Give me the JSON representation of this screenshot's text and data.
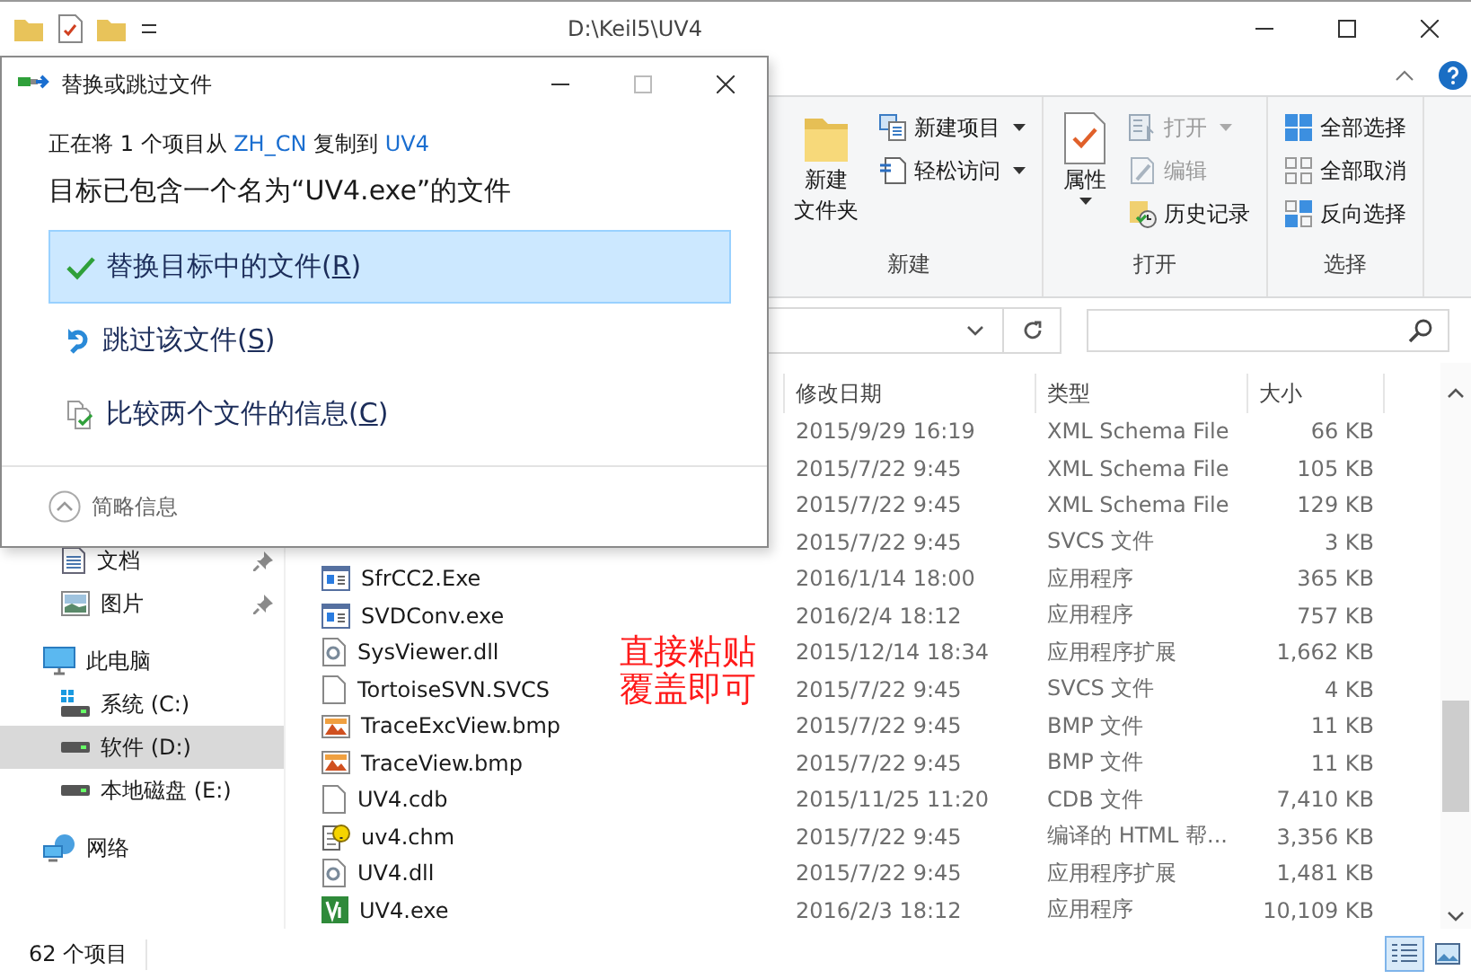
{
  "explorer": {
    "title": "D:\\Keil5\\UV4"
  },
  "ribbon": {
    "groups": [
      {
        "label": "新建",
        "items": [
          {
            "kind": "new-folder",
            "label_lines": [
              "新建",
              "文件夹"
            ],
            "menu": false,
            "disabled": false
          },
          {
            "kind": "new-item",
            "label_lines": [
              "新建项目"
            ],
            "menu": true,
            "disabled": false
          },
          {
            "kind": "easy-access",
            "label_lines": [
              "轻松访问"
            ],
            "menu": true,
            "disabled": false
          }
        ]
      },
      {
        "label": "打开",
        "items": [
          {
            "kind": "properties",
            "label_lines": [
              "属性"
            ],
            "menu": true,
            "disabled": false
          },
          {
            "kind": "open",
            "label_lines": [
              "打开"
            ],
            "menu": true,
            "disabled": true
          },
          {
            "kind": "edit",
            "label_lines": [
              "编辑"
            ],
            "menu": false,
            "disabled": true
          },
          {
            "kind": "history",
            "label_lines": [
              "历史记录"
            ],
            "menu": false,
            "disabled": false
          }
        ]
      },
      {
        "label": "选择",
        "items": [
          {
            "kind": "select-all",
            "label_lines": [
              "全部选择"
            ],
            "menu": false,
            "disabled": false
          },
          {
            "kind": "select-none",
            "label_lines": [
              "全部取消"
            ],
            "menu": false,
            "disabled": false
          },
          {
            "kind": "invert",
            "label_lines": [
              "反向选择"
            ],
            "menu": false,
            "disabled": false
          }
        ]
      }
    ]
  },
  "navigation": {
    "items": [
      {
        "kind": "documents",
        "label": "文档",
        "pinned": true,
        "selected": false
      },
      {
        "kind": "pictures",
        "label": "图片",
        "pinned": true,
        "selected": false
      },
      {
        "kind": "computer",
        "label": "此电脑",
        "pinned": false,
        "selected": false,
        "children": [
          {
            "kind": "system-drive",
            "label": "系统 (C:)",
            "pinned": false,
            "selected": false
          },
          {
            "kind": "drive",
            "label": "软件 (D:)",
            "pinned": false,
            "selected": true
          },
          {
            "kind": "drive",
            "label": "本地磁盘 (E:)",
            "pinned": false,
            "selected": false
          }
        ]
      },
      {
        "kind": "network",
        "label": "网络",
        "pinned": false,
        "selected": false
      }
    ]
  },
  "files": {
    "columns": [
      "修改日期",
      "类型",
      "大小"
    ],
    "rows": [
      {
        "date": "2015/9/29 16:19",
        "type": "XML Schema File",
        "size": "66 KB"
      },
      {
        "date": "2015/7/22 9:45",
        "type": "XML Schema File",
        "size": "105 KB"
      },
      {
        "date": "2015/7/22 9:45",
        "type": "XML Schema File",
        "size": "129 KB"
      },
      {
        "date": "2015/7/22 9:45",
        "type": "SVCS 文件",
        "size": "3 KB"
      },
      {
        "kind": "app",
        "name": "SfrCC2.Exe",
        "date": "2016/1/14 18:00",
        "type": "应用程序",
        "size": "365 KB"
      },
      {
        "kind": "app",
        "name": "SVDConv.exe",
        "date": "2016/2/4 18:12",
        "type": "应用程序",
        "size": "757 KB"
      },
      {
        "kind": "dll",
        "name": "SysViewer.dll",
        "date": "2015/12/14 18:34",
        "type": "应用程序扩展",
        "size": "1,662 KB"
      },
      {
        "kind": "file",
        "name": "TortoiseSVN.SVCS",
        "date": "2015/7/22 9:45",
        "type": "SVCS 文件",
        "size": "4 KB"
      },
      {
        "kind": "bmp",
        "name": "TraceExcView.bmp",
        "date": "2015/7/22 9:45",
        "type": "BMP 文件",
        "size": "11 KB"
      },
      {
        "kind": "bmp",
        "name": "TraceView.bmp",
        "date": "2015/7/22 9:45",
        "type": "BMP 文件",
        "size": "11 KB"
      },
      {
        "kind": "file",
        "name": "UV4.cdb",
        "date": "2015/11/25 11:20",
        "type": "CDB 文件",
        "size": "7,410 KB"
      },
      {
        "kind": "help",
        "name": "uv4.chm",
        "date": "2015/7/22 9:45",
        "type": "编译的 HTML 帮...",
        "size": "3,356 KB"
      },
      {
        "kind": "dll",
        "name": "UV4.dll",
        "date": "2015/7/22 9:45",
        "type": "应用程序扩展",
        "size": "1,481 KB"
      },
      {
        "kind": "uv",
        "name": "UV4.exe",
        "date": "2016/2/3 18:12",
        "type": "应用程序",
        "size": "10,109 KB"
      }
    ]
  },
  "status_bar": {
    "count": "62 个项目",
    "views": [
      {
        "kind": "details",
        "selected": true
      },
      {
        "kind": "large-icons",
        "selected": false
      }
    ]
  },
  "annotation_lines": [
    "直接粘贴",
    "覆盖即可"
  ],
  "dialog": {
    "title": "替换或跳过文件",
    "source_line": [
      {
        "text": "正在将 1 个项目从 ",
        "link": false
      },
      {
        "text": "ZH_CN",
        "link": true
      },
      {
        "text": " 复制到 ",
        "link": false
      },
      {
        "text": "UV4",
        "link": true
      }
    ],
    "heading": "目标已包含一个名为“UV4.exe”的文件",
    "options": [
      {
        "kind": "replace",
        "before": "替换目标中的文件(",
        "mnemonic": "R",
        "after": ")",
        "selected": true
      },
      {
        "kind": "skip",
        "before": "跳过该文件(",
        "mnemonic": "S",
        "after": ")",
        "selected": false
      },
      {
        "kind": "compare",
        "before": "比较两个文件的信息(",
        "mnemonic": "C",
        "after": ")",
        "selected": false
      }
    ],
    "footer": "简略信息"
  }
}
